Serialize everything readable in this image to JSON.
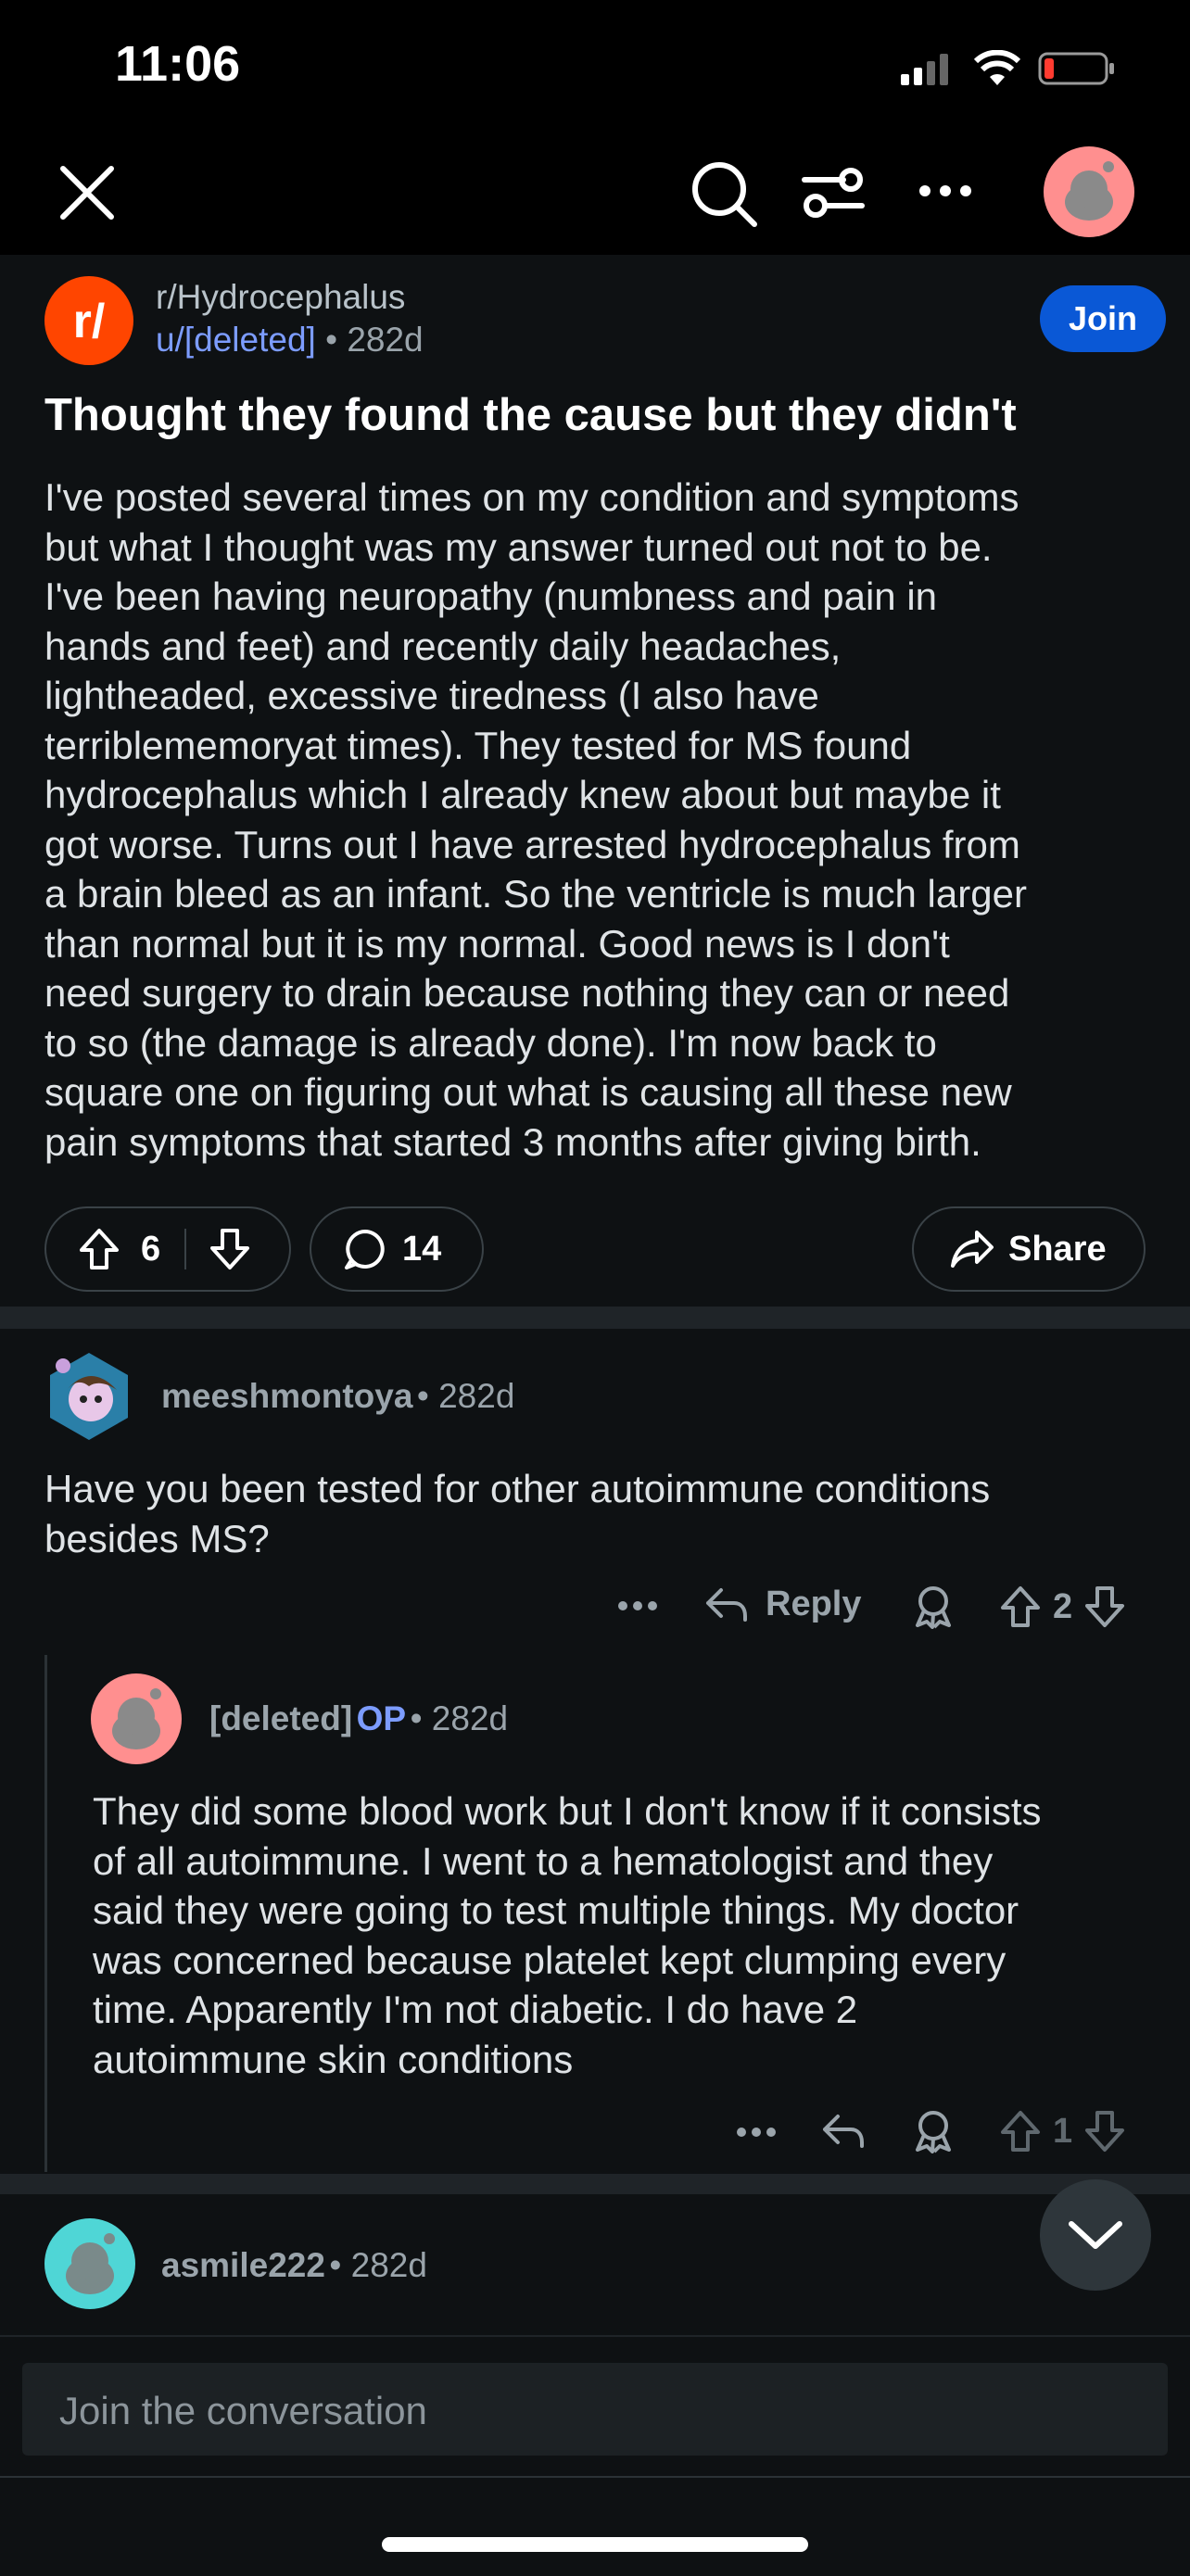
{
  "status": {
    "time": "11:06"
  },
  "post": {
    "subreddit": "r/Hydrocephalus",
    "author": "u/[deleted]",
    "age": "• 282d",
    "join_label": "Join",
    "title": "Thought they found the cause but they didn't",
    "body": "I've posted several times on my condition and symptoms\nbut what I thought was my answer turned out not to be.\nI've been having neuropathy (numbness and pain in\nhands and feet) and recently daily headaches,\nlightheaded, excessive tiredness (I also have\nterriblememoryat times). They tested for MS found\nhydrocephalus which I already knew about but maybe it\ngot worse.  Turns out I have arrested hydrocephalus from\na brain bleed as an infant.  So the ventricle is much larger\nthan normal but it is my normal. Good news is I don't\nneed surgery to drain because nothing they can or need\nto so (the damage is already done). I'm now back to\nsquare one on figuring out what is causing all these new\npain symptoms that started 3 months after giving birth.",
    "votes": "6",
    "comments": "14",
    "share_label": "Share"
  },
  "comments": [
    {
      "user": "meeshmontoya",
      "age": "• 282d",
      "body": "Have you been tested for other autoimmune conditions\nbesides MS?",
      "reply_label": "Reply",
      "votes": "2"
    },
    {
      "user": "[deleted]",
      "op_badge": "OP",
      "age": "• 282d",
      "body": "They did some blood work but I don't know if it consists\nof all autoimmune.  I went to a hematologist and they\nsaid they were going to test multiple things. My doctor\nwas concerned because platelet kept clumping every\ntime. Apparently I'm not diabetic.  I do have 2\nautoimmune skin conditions",
      "votes": "1"
    },
    {
      "user": "asmile222",
      "age": "• 282d"
    }
  ],
  "composer": {
    "placeholder": "Join the conversation"
  },
  "colors": {
    "accent": "#0a58d6",
    "link": "#7c9cff",
    "subreddit_icon": "#ff4500",
    "background": "#0e1113"
  }
}
